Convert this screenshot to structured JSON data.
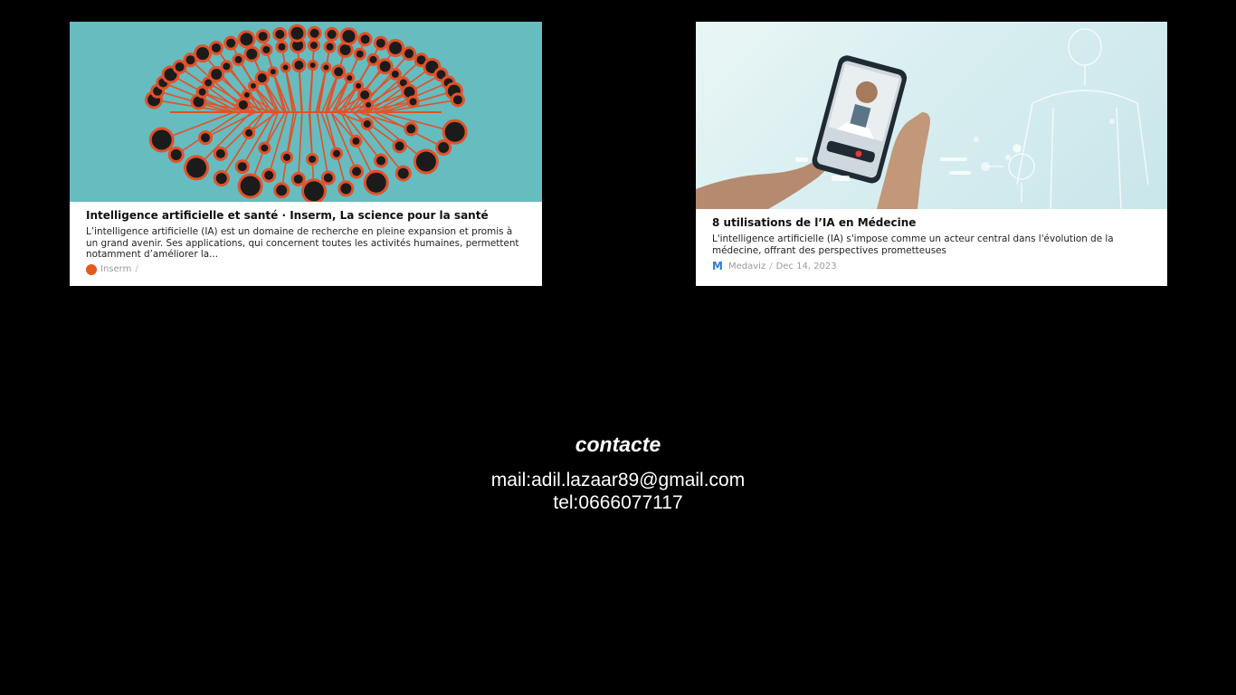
{
  "cards": [
    {
      "title": "Intelligence artificielle et santé · Inserm, La science pour la santé",
      "description": "L’intelligence artificielle (IA) est un domaine de recherche en pleine expansion et promis à un grand avenir. Ses applications, qui concernent toutes les activités humaines, permettent notamment d’améliorer la...",
      "source": "Inserm",
      "separator": "/",
      "date": "",
      "logo_icon": "inserm-logo-icon",
      "image_icon": "neural-brain-circuit-illustration",
      "image_bg": "#66bcbe",
      "accent": "#e0522a"
    },
    {
      "title": "8 utilisations de l’IA en Médecine",
      "description": "L'intelligence artificielle (IA) s'impose comme un acteur central dans l'évolution de la médecine, offrant des perspectives prometteuses",
      "source": "Medaviz",
      "separator": "/",
      "date": "Dec 14, 2023",
      "logo_text": "M",
      "logo_icon": "medaviz-logo-icon",
      "image_icon": "smartphone-doctor-photo",
      "accent": "#2a7bd4"
    }
  ],
  "contact": {
    "title": "contacte",
    "mail": "mail:adil.lazaar89@gmail.com",
    "tel": "tel:0666077117"
  }
}
